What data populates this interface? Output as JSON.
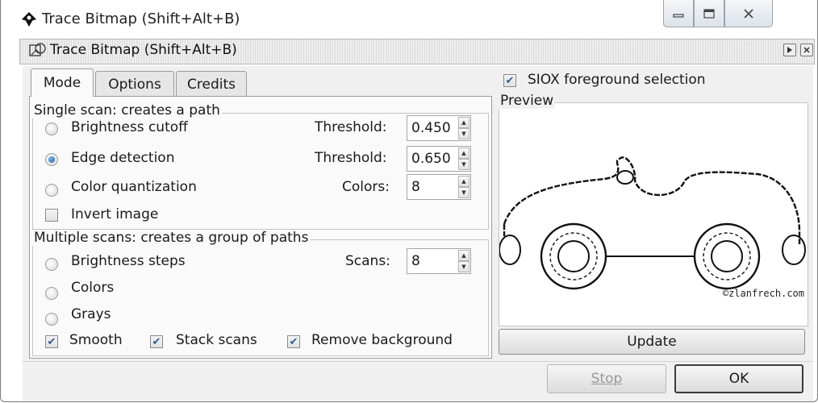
{
  "window": {
    "title": "Trace Bitmap (Shift+Alt+B)"
  },
  "dock": {
    "title": "Trace Bitmap (Shift+Alt+B)"
  },
  "tabs": [
    {
      "label": "Mode"
    },
    {
      "label": "Options"
    },
    {
      "label": "Credits"
    }
  ],
  "single_scan": {
    "legend": "Single scan: creates a path",
    "brightness": {
      "label": "Brightness cutoff",
      "param_label": "Threshold:",
      "value": "0.450"
    },
    "edge": {
      "label": "Edge detection",
      "param_label": "Threshold:",
      "value": "0.650"
    },
    "color": {
      "label": "Color quantization",
      "param_label": "Colors:",
      "value": "8"
    },
    "invert": {
      "label": "Invert image"
    }
  },
  "multi_scan": {
    "legend": "Multiple scans: creates a group of paths",
    "steps": {
      "label": "Brightness steps",
      "param_label": "Scans:",
      "value": "8"
    },
    "colors": {
      "label": "Colors"
    },
    "grays": {
      "label": "Grays"
    },
    "smooth": {
      "label": "Smooth"
    },
    "stack": {
      "label": "Stack scans"
    },
    "remove_bg": {
      "label": "Remove background"
    }
  },
  "siox": {
    "label": "SIOX foreground selection",
    "checked": true
  },
  "preview": {
    "legend": "Preview",
    "watermark": "©zlanfrech.com"
  },
  "buttons": {
    "update": "Update",
    "stop": "Stop",
    "ok": "OK"
  }
}
